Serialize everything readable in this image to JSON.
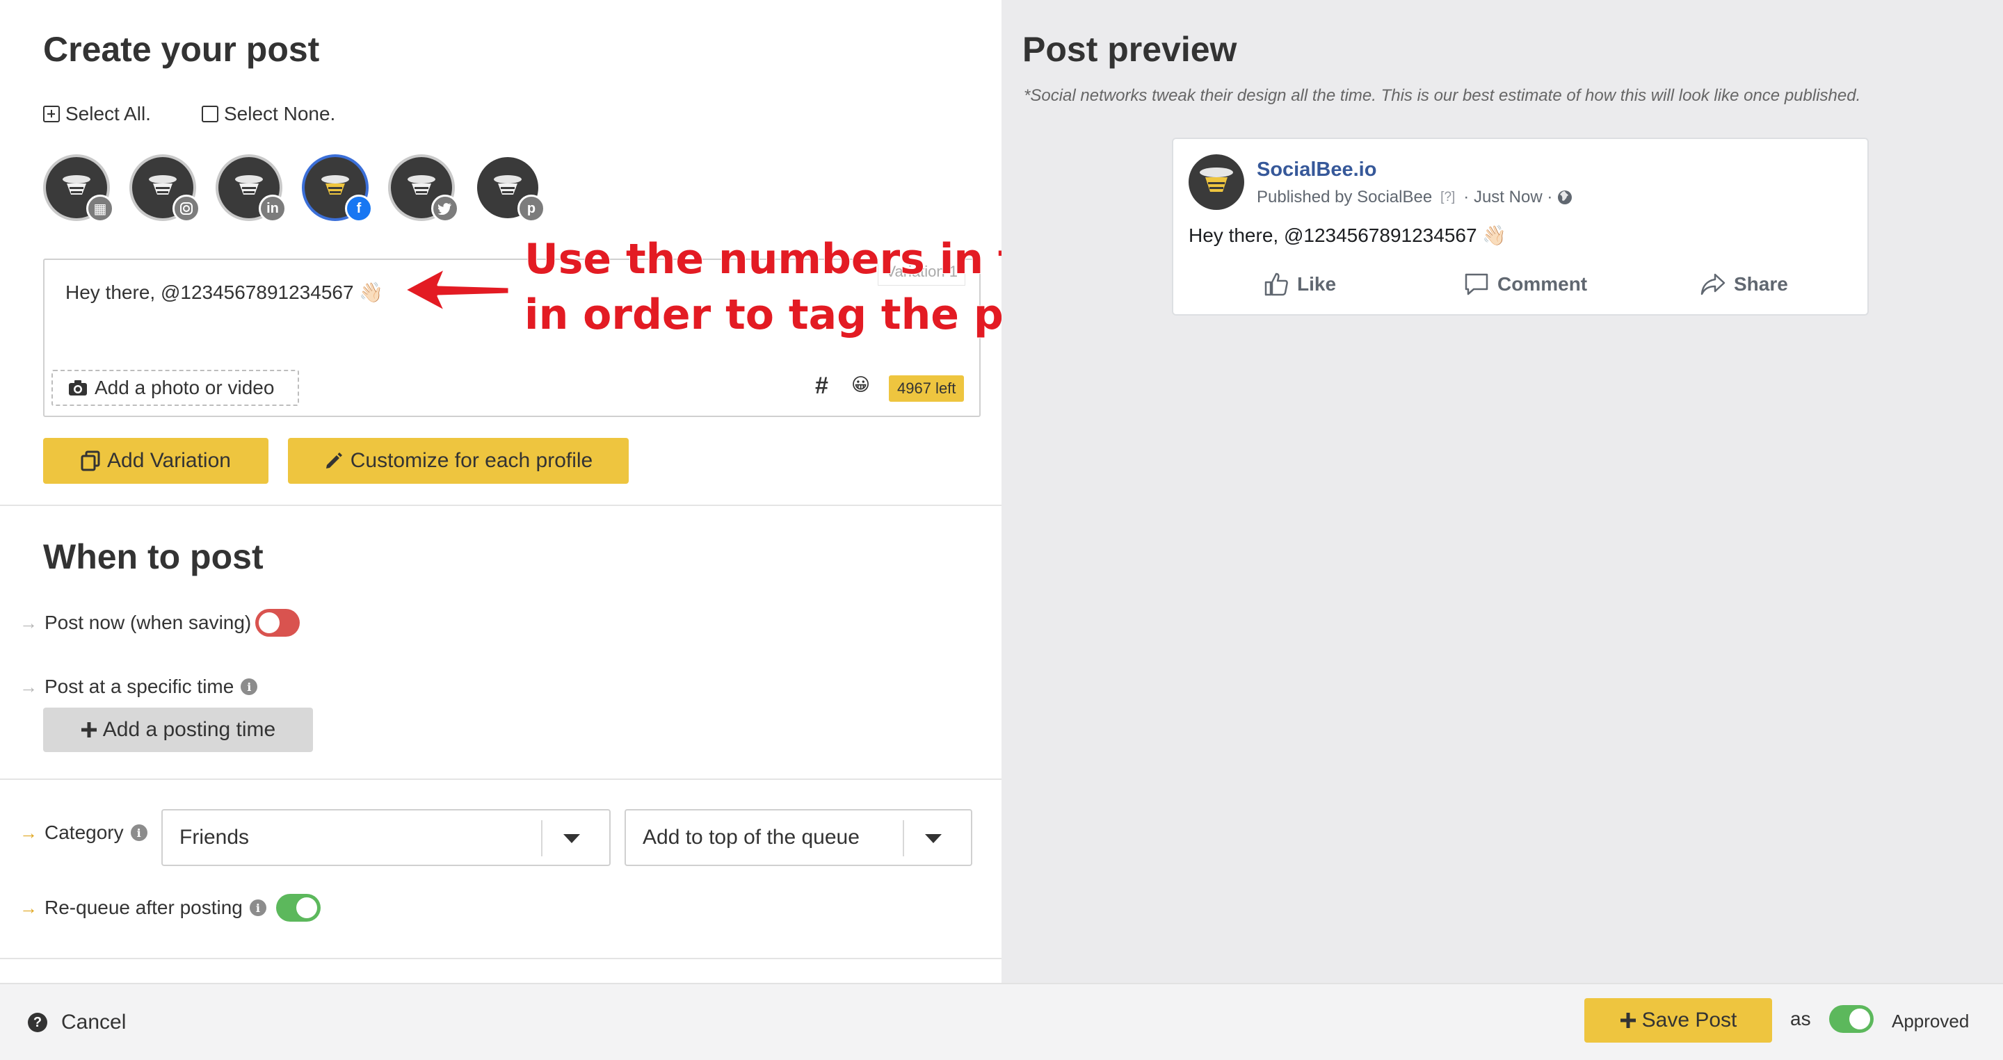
{
  "composer": {
    "title": "Create your post",
    "select_all": "Select All.",
    "select_none": "Select None.",
    "profiles": [
      {
        "network": "google-my-business",
        "badge_icon": "store-icon",
        "selected": false
      },
      {
        "network": "instagram",
        "badge_icon": "instagram-icon",
        "selected": false
      },
      {
        "network": "linkedin",
        "badge_icon": "linkedin-icon",
        "badge_text": "in",
        "selected": false
      },
      {
        "network": "facebook",
        "badge_icon": "facebook-icon",
        "badge_text": "f",
        "selected": true
      },
      {
        "network": "twitter",
        "badge_icon": "twitter-icon",
        "selected": false
      },
      {
        "network": "pinterest",
        "badge_icon": "pinterest-icon",
        "badge_text": "p",
        "selected": false
      }
    ],
    "variation_tab": "Variation 1",
    "post_text": "Hey there, @1234567891234567 👋🏻",
    "add_media": "Add a photo or video",
    "hashtag_symbol": "#",
    "emoji_symbol": "😀",
    "chars_left": "4967 left",
    "add_variation": "Add Variation",
    "customize": "Customize for each profile"
  },
  "annotation": {
    "line1": "Use the numbers in the URL",
    "line2": "in order to tag the page.",
    "color": "#e31b23"
  },
  "when": {
    "title": "When to post",
    "post_now": "Post now (when saving)",
    "post_now_on": false,
    "specific_time": "Post at a specific time",
    "add_time": "Add a posting time"
  },
  "category": {
    "label": "Category",
    "selected": "Friends",
    "queue_position": "Add to top of the queue",
    "requeue": "Re-queue after posting",
    "requeue_on": true
  },
  "preview": {
    "title": "Post preview",
    "note": "*Social networks tweak their design all the time. This is our best estimate of how this will look like once published.",
    "page_name": "SocialBee.io",
    "published_by": "Published by SocialBee",
    "question": "[?]",
    "time": "· Just Now ·",
    "text": "Hey there, @1234567891234567 👋🏻",
    "like": "Like",
    "comment": "Comment",
    "share": "Share"
  },
  "footer": {
    "cancel": "Cancel",
    "save": "Save Post",
    "as": "as",
    "approved": "Approved",
    "approved_on": true
  },
  "colors": {
    "accent_yellow": "#eec53f",
    "facebook_blue": "#1877f2",
    "toggle_off": "#d9534f",
    "toggle_on": "#5cb85c"
  }
}
